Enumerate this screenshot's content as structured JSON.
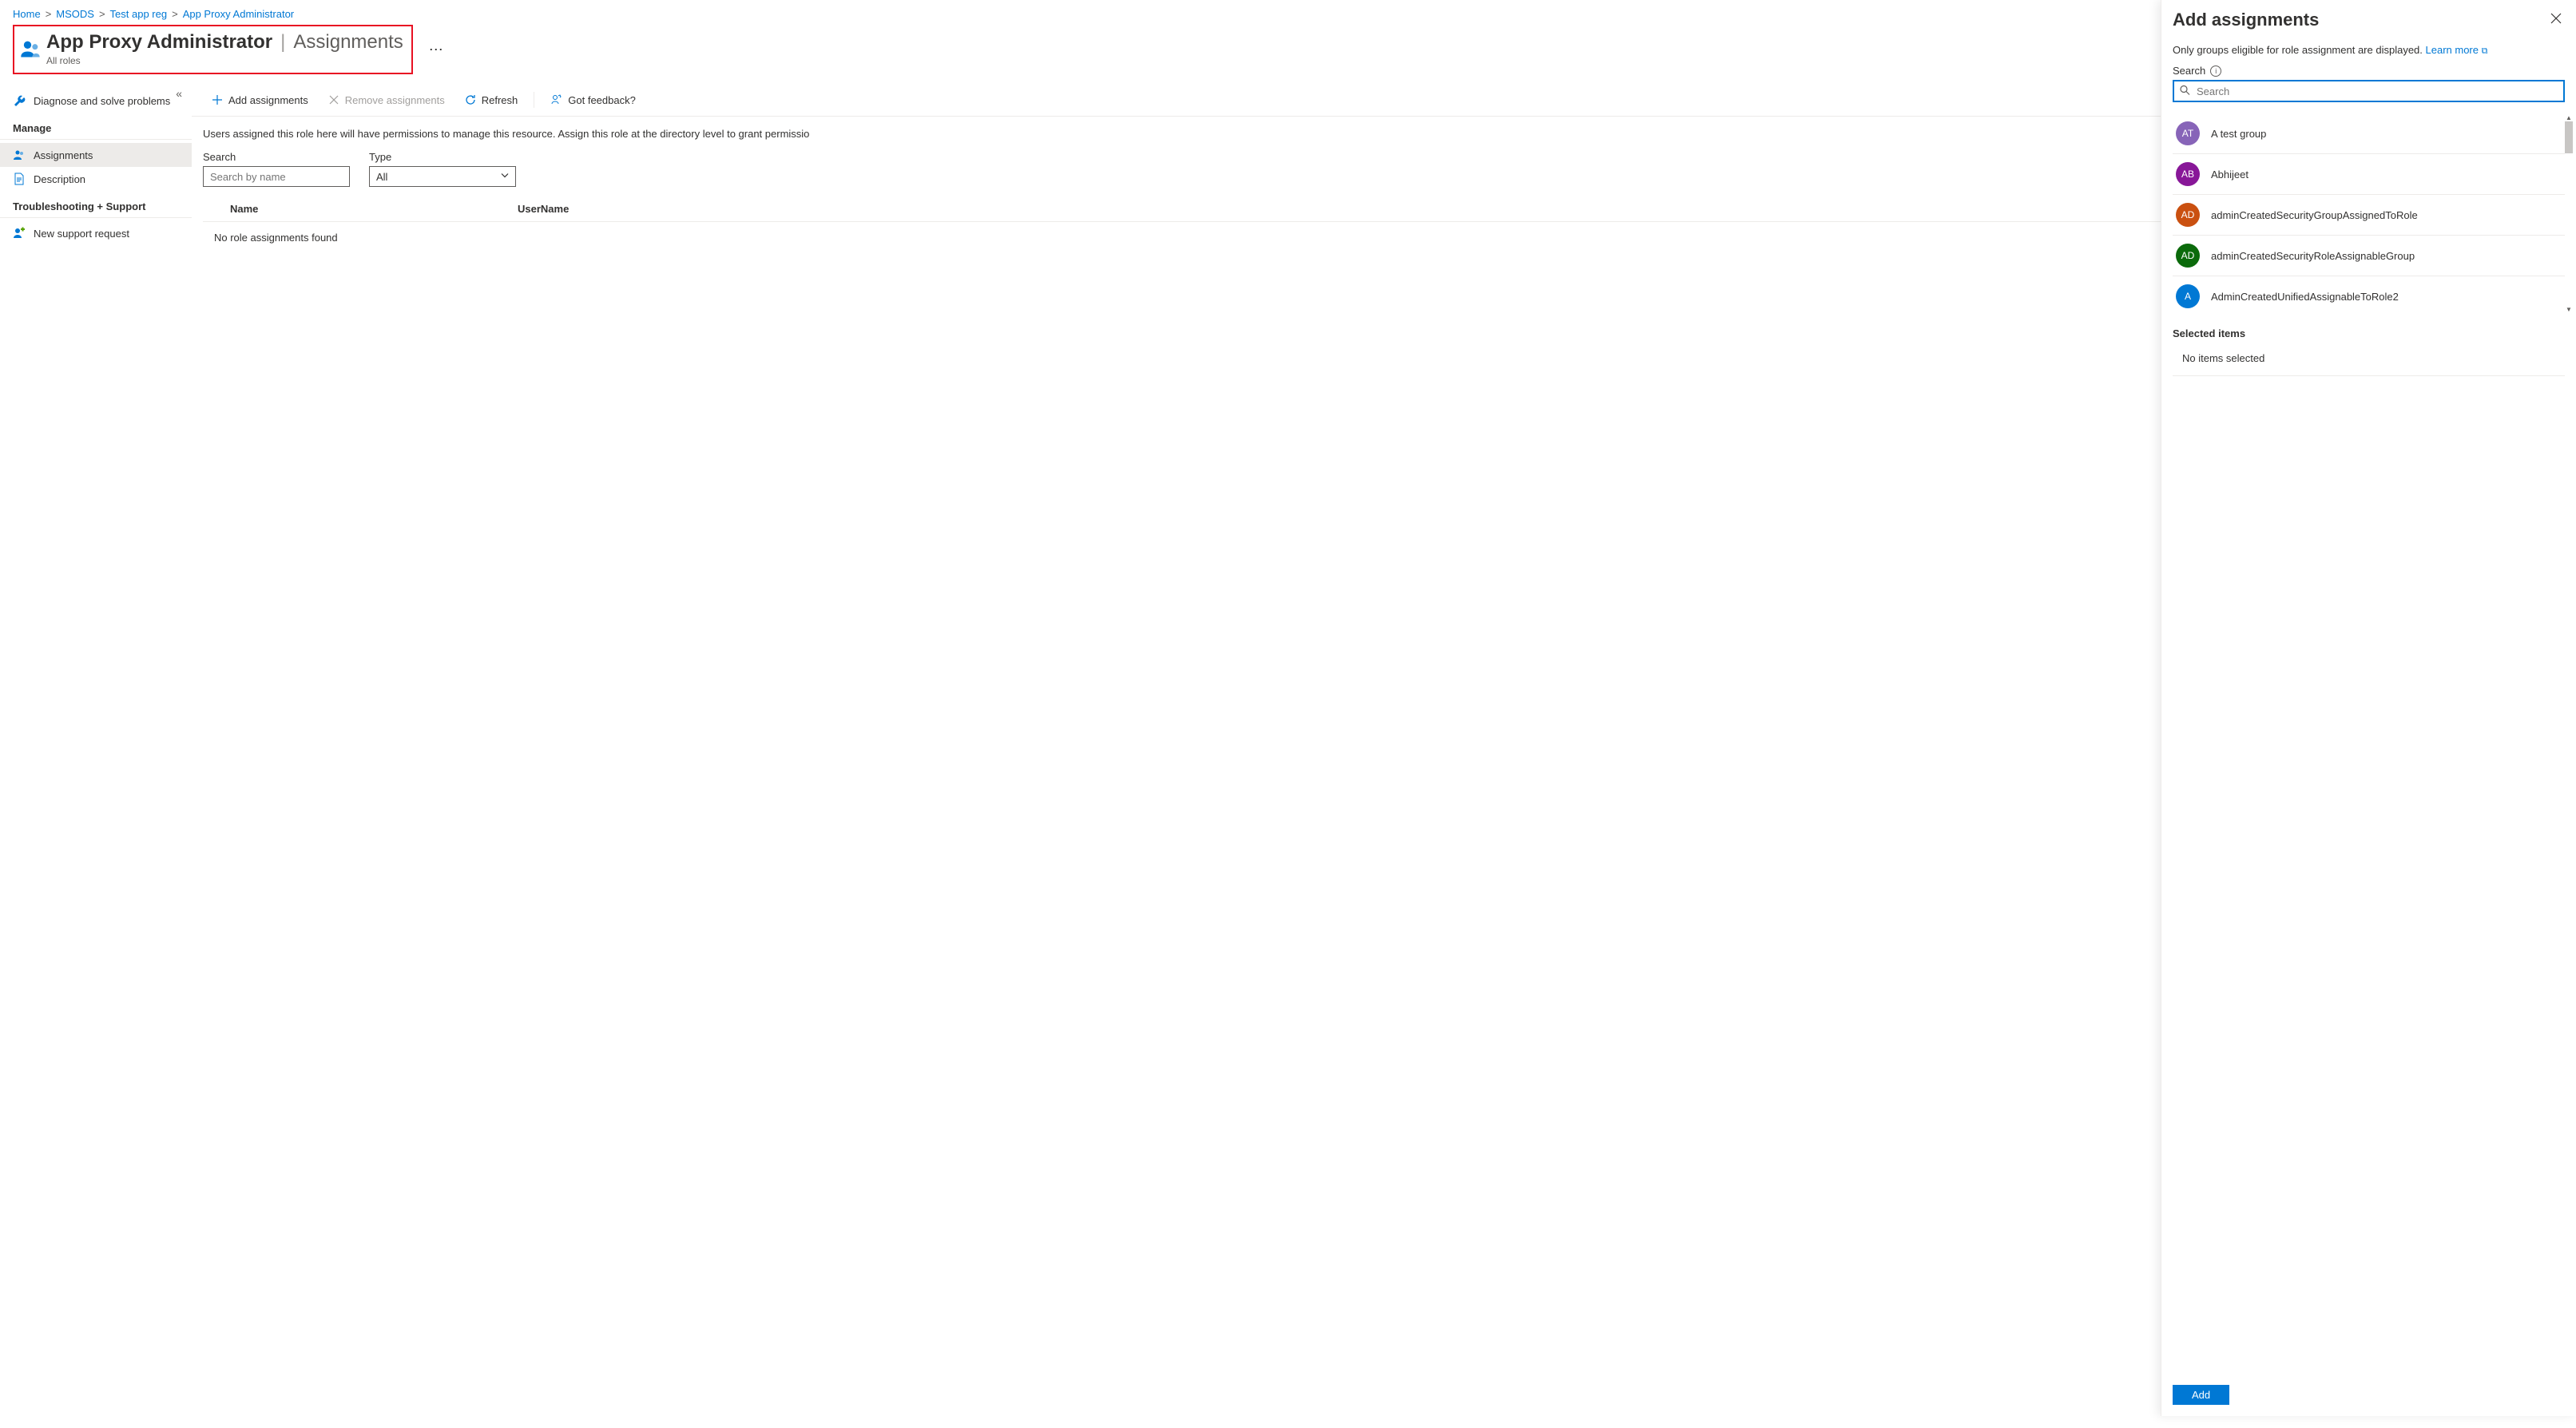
{
  "breadcrumb": {
    "items": [
      "Home",
      "MSODS",
      "Test app reg",
      "App Proxy Administrator"
    ]
  },
  "header": {
    "title_main": "App Proxy Administrator",
    "title_sub": "Assignments",
    "subtitle": "All roles"
  },
  "sidebar": {
    "diagnose": "Diagnose and solve problems",
    "section_manage": "Manage",
    "assignments": "Assignments",
    "description": "Description",
    "section_troubleshoot": "Troubleshooting + Support",
    "support": "New support request"
  },
  "toolbar": {
    "add": "Add assignments",
    "remove": "Remove assignments",
    "refresh": "Refresh",
    "feedback": "Got feedback?"
  },
  "main": {
    "desc": "Users assigned this role here will have permissions to manage this resource. Assign this role at the directory level to grant permissio",
    "search_label": "Search",
    "search_placeholder": "Search by name",
    "type_label": "Type",
    "type_value": "All",
    "col_name": "Name",
    "col_user": "UserName",
    "empty": "No role assignments found"
  },
  "blade": {
    "title": "Add assignments",
    "info": "Only groups eligible for role assignment are displayed.",
    "learn": "Learn more",
    "search_label": "Search",
    "search_placeholder": "Search",
    "groups": [
      {
        "initials": "AT",
        "name": "A test group",
        "color": "#8764b8"
      },
      {
        "initials": "AB",
        "name": "Abhijeet",
        "color": "#881798"
      },
      {
        "initials": "AD",
        "name": "adminCreatedSecurityGroupAssignedToRole",
        "color": "#ca5010"
      },
      {
        "initials": "AD",
        "name": "adminCreatedSecurityRoleAssignableGroup",
        "color": "#0b6a0b"
      },
      {
        "initials": "A",
        "name": "AdminCreatedUnifiedAssignableToRole2",
        "color": "#0078d4"
      }
    ],
    "selected_head": "Selected items",
    "selected_empty": "No items selected",
    "add_btn": "Add"
  }
}
